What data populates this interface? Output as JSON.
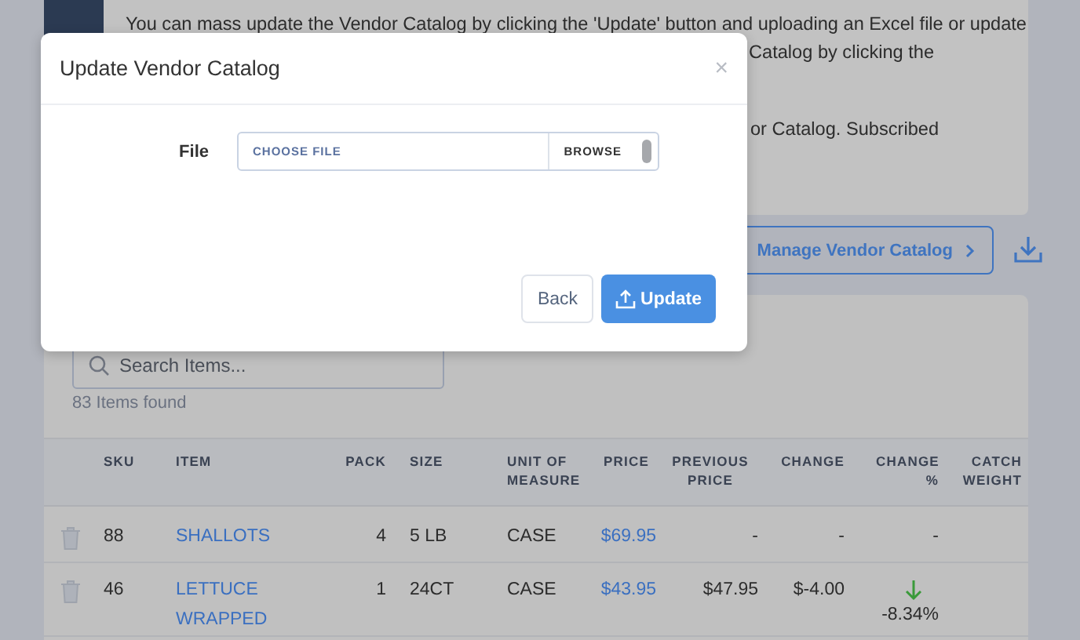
{
  "info": {
    "lines": [
      "You can mass update the Vendor Catalog by clicking the 'Update' button and uploading an Excel file or update",
      "Catalog by clicking the",
      "or Catalog. Subscribed"
    ]
  },
  "manage_button": {
    "label": "Manage Vendor Catalog"
  },
  "search": {
    "placeholder": "Search Items..."
  },
  "items_found": "83 Items found",
  "table": {
    "columns": [
      "SKU",
      "ITEM",
      "PACK",
      "SIZE",
      "UNIT OF MEASURE",
      "PRICE",
      "PREVIOUS PRICE",
      "CHANGE",
      "CHANGE %",
      "CATCH WEIGHT"
    ],
    "rows": [
      {
        "sku": "88",
        "item": "SHALLOTS",
        "pack": "4",
        "size": "5 LB",
        "unit": "CASE",
        "price": "$69.95",
        "previous_price": "-",
        "change": "-",
        "change_pct": "-",
        "decreased": false
      },
      {
        "sku": "46",
        "item": "LETTUCE WRAPPED",
        "pack": "1",
        "size": "24CT",
        "unit": "CASE",
        "price": "$43.95",
        "previous_price": "$47.95",
        "change": "$-4.00",
        "change_pct": "-8.34%",
        "decreased": true
      }
    ]
  },
  "modal": {
    "title": "Update Vendor Catalog",
    "close": "×",
    "file_label": "File",
    "file_placeholder": "CHOOSE FILE",
    "browse": "BROWSE",
    "buttons": [
      {
        "label": "Back",
        "kind": "secondary"
      },
      {
        "label": "Update",
        "kind": "primary"
      }
    ]
  }
}
